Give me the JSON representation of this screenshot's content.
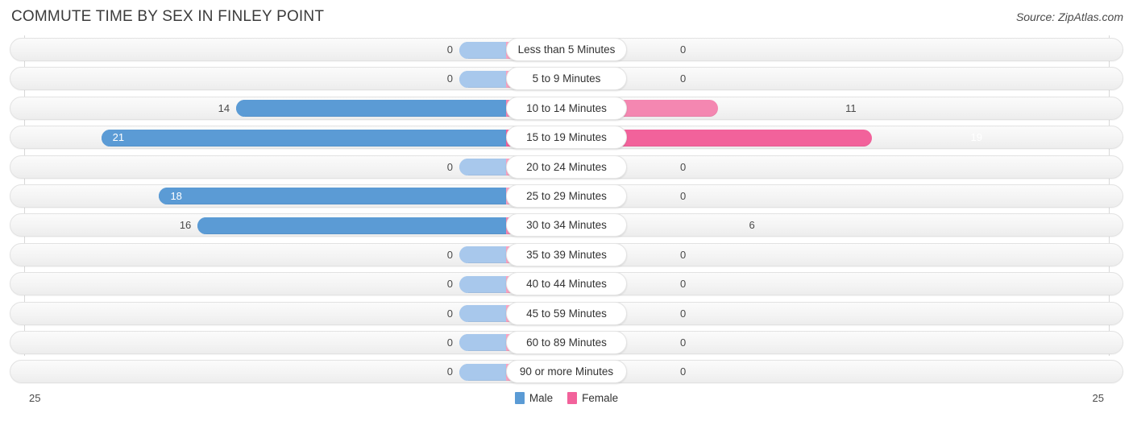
{
  "header": {
    "title": "COMMUTE TIME BY SEX IN FINLEY POINT",
    "source": "Source: ZipAtlas.com"
  },
  "legend": {
    "male_label": "Male",
    "female_label": "Female",
    "male_color": "#5b9bd5",
    "female_color": "#f2629b"
  },
  "axis": {
    "left_tick": "25",
    "right_tick": "25",
    "max": 25
  },
  "chart_data": {
    "type": "bar",
    "orientation": "horizontal-diverging",
    "title": "COMMUTE TIME BY SEX IN FINLEY POINT",
    "xlabel": "",
    "ylabel": "",
    "xlim": [
      25,
      25
    ],
    "grid": false,
    "legend_position": "bottom-center",
    "categories": [
      "Less than 5 Minutes",
      "5 to 9 Minutes",
      "10 to 14 Minutes",
      "15 to 19 Minutes",
      "20 to 24 Minutes",
      "25 to 29 Minutes",
      "30 to 34 Minutes",
      "35 to 39 Minutes",
      "40 to 44 Minutes",
      "45 to 59 Minutes",
      "60 to 89 Minutes",
      "90 or more Minutes"
    ],
    "series": [
      {
        "name": "Male",
        "values": [
          0,
          0,
          14,
          21,
          0,
          18,
          16,
          0,
          0,
          0,
          0,
          0
        ]
      },
      {
        "name": "Female",
        "values": [
          0,
          0,
          11,
          19,
          0,
          0,
          6,
          0,
          0,
          0,
          0,
          0
        ]
      }
    ]
  },
  "rows": [
    {
      "label": "Less than 5 Minutes",
      "male": "0",
      "female": "0",
      "male_val": 0,
      "female_val": 0
    },
    {
      "label": "5 to 9 Minutes",
      "male": "0",
      "female": "0",
      "male_val": 0,
      "female_val": 0
    },
    {
      "label": "10 to 14 Minutes",
      "male": "14",
      "female": "11",
      "male_val": 14,
      "female_val": 11
    },
    {
      "label": "15 to 19 Minutes",
      "male": "21",
      "female": "19",
      "male_val": 21,
      "female_val": 19
    },
    {
      "label": "20 to 24 Minutes",
      "male": "0",
      "female": "0",
      "male_val": 0,
      "female_val": 0
    },
    {
      "label": "25 to 29 Minutes",
      "male": "18",
      "female": "0",
      "male_val": 18,
      "female_val": 0
    },
    {
      "label": "30 to 34 Minutes",
      "male": "16",
      "female": "6",
      "male_val": 16,
      "female_val": 6
    },
    {
      "label": "35 to 39 Minutes",
      "male": "0",
      "female": "0",
      "male_val": 0,
      "female_val": 0
    },
    {
      "label": "40 to 44 Minutes",
      "male": "0",
      "female": "0",
      "male_val": 0,
      "female_val": 0
    },
    {
      "label": "45 to 59 Minutes",
      "male": "0",
      "female": "0",
      "male_val": 0,
      "female_val": 0
    },
    {
      "label": "60 to 89 Minutes",
      "male": "0",
      "female": "0",
      "male_val": 0,
      "female_val": 0
    },
    {
      "label": "90 or more Minutes",
      "male": "0",
      "female": "0",
      "male_val": 0,
      "female_val": 0
    }
  ]
}
